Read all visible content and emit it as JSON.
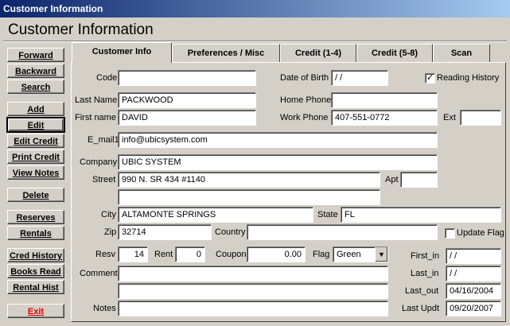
{
  "window": {
    "title": "Customer Information"
  },
  "heading": "Customer Information",
  "buttons": {
    "forward": "Forward",
    "backward": "Backward",
    "search": "Search",
    "add": "Add",
    "edit": "Edit",
    "edit_credit": "Edit Credit",
    "print_credit": "Print Credit",
    "view_notes": "View Notes",
    "delete": "Delete",
    "reserves": "Reserves",
    "rentals": "Rentals",
    "cred_history": "Cred History",
    "books_read": "Books Read",
    "rental_hist": "Rental Hist",
    "exit": "Exit"
  },
  "tabs": [
    "Customer Info",
    "Preferences / Misc",
    "Credit (1-4)",
    "Credit (5-8)",
    "Scan"
  ],
  "labels": {
    "code": "Code",
    "dob": "Date of Birth",
    "reading_history": "Reading History",
    "last_name": "Last Name",
    "home_phone": "Home Phone",
    "first_name": "First name",
    "work_phone": "Work Phone",
    "ext": "Ext",
    "email": "E_mail1",
    "company": "Company",
    "street": "Street",
    "apt": "Apt",
    "city": "City",
    "state": "State",
    "zip": "Zip",
    "country": "Country",
    "update_flag": "Update Flag",
    "resv": "Resv",
    "rent": "Rent",
    "coupon": "Coupon",
    "flag": "Flag",
    "first_in": "First_in",
    "last_in": "Last_in",
    "comment": "Comment",
    "last_out": "Last_out",
    "notes": "Notes",
    "last_updt": "Last Updt"
  },
  "fields": {
    "code": "",
    "dob": " /  /",
    "reading_history_checked": true,
    "last_name": "PACKWOOD",
    "home_phone": "",
    "first_name": "DAVID",
    "work_phone": "407-551-0772",
    "ext": "",
    "email": "info@ubicsystem.com",
    "company": "UBIC SYSTEM",
    "street1": "990 N. SR 434 #1140",
    "apt": "",
    "street2": "",
    "city": "ALTAMONTE SPRINGS",
    "state": "FL",
    "zip": "32714",
    "country": "",
    "update_flag_checked": false,
    "resv": "14",
    "rent": "0",
    "coupon": "0.00",
    "flag": "Green",
    "first_in": " /  /",
    "last_in": " /  /",
    "comment1": "",
    "comment2": "",
    "last_out": "04/16/2004",
    "notes": "",
    "last_updt": "09/20/2007"
  },
  "check_glyph": "✓",
  "dropdown_glyph": "▼"
}
